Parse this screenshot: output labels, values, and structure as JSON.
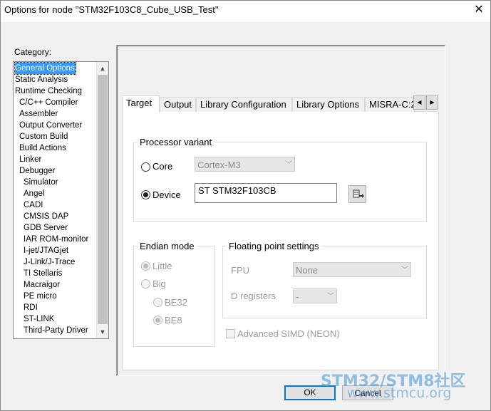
{
  "window": {
    "title": "Options for node \"STM32F103C8_Cube_USB_Test\"",
    "close_glyph": "✕"
  },
  "category": {
    "label": "Category:",
    "items": [
      "General Options",
      "Static Analysis",
      "Runtime Checking",
      "C/C++ Compiler",
      "Assembler",
      "Output Converter",
      "Custom Build",
      "Build Actions",
      "Linker",
      "Debugger",
      "Simulator",
      "Angel",
      "CADI",
      "CMSIS DAP",
      "GDB Server",
      "IAR ROM-monitor",
      "I-jet/JTAGjet",
      "J-Link/J-Trace",
      "TI Stellaris",
      "Macraigor",
      "PE micro",
      "RDI",
      "ST-LINK",
      "Third-Party Driver"
    ],
    "selected_index": 0
  },
  "tabs": [
    "Target",
    "Output",
    "Library Configuration",
    "Library Options",
    "MISRA-C:2"
  ],
  "active_tab_index": 0,
  "processor": {
    "legend": "Processor variant",
    "core_label": "Core",
    "core_value": "Cortex-M3",
    "device_label": "Device",
    "device_value": "ST STM32F103CB",
    "selected": "device"
  },
  "endian": {
    "legend": "Endian mode",
    "little": "Little",
    "big": "Big",
    "be32": "BE32",
    "be8": "BE8"
  },
  "fp": {
    "legend": "Floating point settings",
    "fpu_label": "FPU",
    "fpu_value": "None",
    "dreg_label": "D registers",
    "dreg_value": "-",
    "simd_label": "Advanced SIMD (NEON)"
  },
  "buttons": {
    "ok": "OK",
    "cancel": "Cancel"
  },
  "watermark": {
    "line1": "STM32/STM8社区",
    "line2": "www.stmcu.org"
  }
}
